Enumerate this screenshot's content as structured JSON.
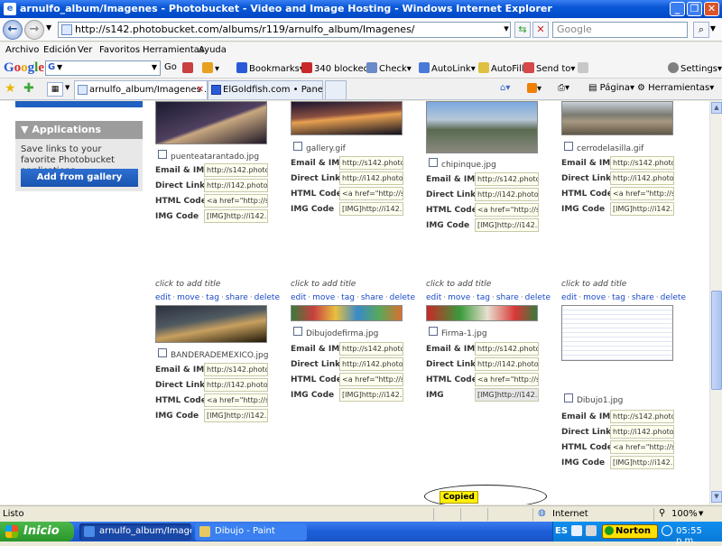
{
  "window": {
    "title": "arnulfo_album/Imagenes - Photobucket - Video and Image Hosting - Windows Internet Explorer"
  },
  "address_bar": {
    "url": "http://s142.photobucket.com/albums/r119/arnulfo_album/Imagenes/",
    "search_placeholder": "Google"
  },
  "menu": [
    "Archivo",
    "Edición",
    "Ver",
    "Favoritos",
    "Herramientas",
    "Ayuda"
  ],
  "google_toolbar": {
    "logo": "Google",
    "search_letter": "G",
    "go_label": "Go",
    "bookmarks_label": "Bookmarks",
    "blocked_label": "340 blocked",
    "check_label": "Check",
    "autolink_label": "AutoLink",
    "autofill_label": "AutoFill",
    "sendto_label": "Send to",
    "settings_label": "Settings"
  },
  "tabs": [
    {
      "label": "arnulfo_album/Imagenes ..."
    },
    {
      "label": "ElGoldfish.com • Panel de Co..."
    }
  ],
  "command_bar": {
    "pagina_label": "Página",
    "herramientas_label": "Herramientas"
  },
  "sidebar": {
    "heading": "Applications",
    "description": "Save links to your favorite Photobucket applications.",
    "button": "Add from gallery"
  },
  "field_labels": {
    "email": "Email & IM",
    "direct": "Direct Link",
    "html": "HTML Code",
    "img": "IMG Code"
  },
  "field_values": {
    "email": "http://s142.photobu",
    "direct": "http://i142.photobu",
    "html": "<a href=\"http://s142",
    "img": "[IMG]http://i142.ph"
  },
  "row1_items": [
    {
      "filename": "puenteatarantado.jpg"
    },
    {
      "filename": "gallery.gif"
    },
    {
      "filename": "chipinque.jpg"
    },
    {
      "filename": "cerrodelasilla.gif"
    }
  ],
  "row2_items": [
    {
      "filename": "BANDERADEMEXICO.jpg"
    },
    {
      "filename": "Dibujodefirma.jpg"
    },
    {
      "filename": "Firma-1.jpg"
    },
    {
      "filename": "Dibujo1.jpg"
    }
  ],
  "cell_common": {
    "add_title": "click to add title",
    "actions": [
      "edit",
      "move",
      "tag",
      "share",
      "delete"
    ],
    "img_label_partial": "IMG"
  },
  "copied_badge": "Copied",
  "status": {
    "left": "Listo",
    "zone": "Internet",
    "zoom": "100%"
  },
  "taskbar": {
    "start": "Inicio",
    "tasks": [
      {
        "label": "arnulfo_album/Image..."
      },
      {
        "label": "Dibujo - Paint"
      }
    ],
    "lang": "ES",
    "norton": "Norton",
    "clock": "05:55 p.m."
  },
  "colors": {
    "title_blue": "#0a58d6",
    "link_blue": "#1a4acc",
    "copied_yellow": "#fff200",
    "sidebar_button": "#1a55b0",
    "start_green": "#2a962a"
  }
}
